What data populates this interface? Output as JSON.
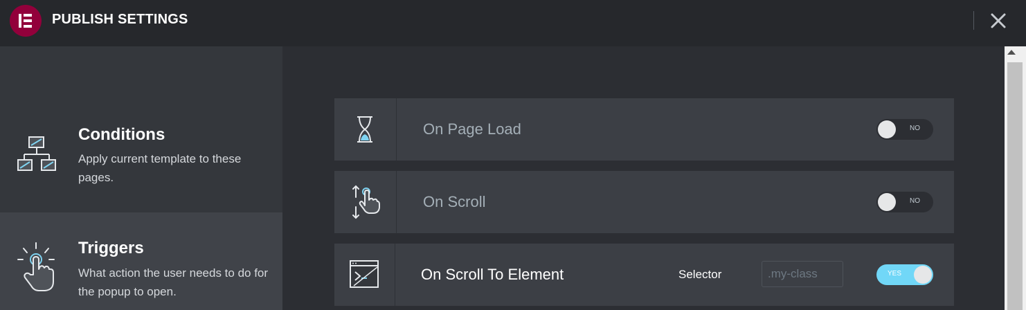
{
  "header": {
    "title": "PUBLISH SETTINGS",
    "logo_icon": "elementor-logo-icon",
    "close_icon": "close-icon"
  },
  "sidebar": {
    "items": [
      {
        "title": "Conditions",
        "description": "Apply current template to these pages.",
        "icon": "sitemap-icon",
        "active": false
      },
      {
        "title": "Triggers",
        "description": "What action the user needs to do for the popup to open.",
        "icon": "click-pointer-icon",
        "active": true
      }
    ]
  },
  "triggers": [
    {
      "label": "On Page Load",
      "icon": "hourglass-icon",
      "toggle": "NO",
      "enabled": false
    },
    {
      "label": "On Scroll",
      "icon": "scroll-hand-icon",
      "toggle": "NO",
      "enabled": false
    },
    {
      "label": "On Scroll To Element",
      "icon": "scroll-to-element-icon",
      "toggle": "YES",
      "enabled": true,
      "selector_label": "Selector",
      "selector_placeholder": ".my-class",
      "selector_value": ""
    }
  ],
  "colors": {
    "brand": "#92003b",
    "accent": "#71d7f7",
    "header_bg": "#26282c",
    "panel_bg": "#2c2e33",
    "row_bg": "#3c3f45"
  }
}
